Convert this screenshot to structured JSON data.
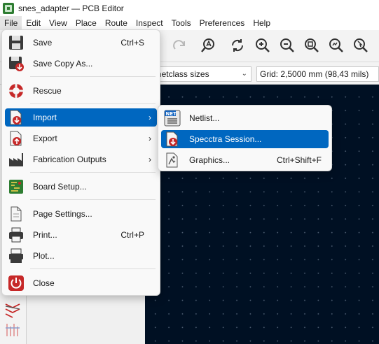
{
  "window": {
    "title": "snes_adapter — PCB Editor"
  },
  "menubar": [
    {
      "label": "File",
      "active": true
    },
    {
      "label": "Edit"
    },
    {
      "label": "View"
    },
    {
      "label": "Place"
    },
    {
      "label": "Route"
    },
    {
      "label": "Inspect"
    },
    {
      "label": "Tools"
    },
    {
      "label": "Preferences"
    },
    {
      "label": "Help"
    }
  ],
  "toolbar2": {
    "netclass_combo": "Track: use netclass sizes",
    "grid_combo": "Grid: 2,5000 mm (98,43 mils)"
  },
  "file_menu": {
    "items": [
      {
        "label": "Save",
        "shortcut": "Ctrl+S",
        "icon": "save-icon"
      },
      {
        "label": "Save Copy As...",
        "icon": "save-copy-icon"
      },
      {
        "label": "Rescue",
        "icon": "rescue-icon"
      },
      {
        "label": "Import",
        "icon": "import-icon",
        "submenu": true,
        "highlighted": true
      },
      {
        "label": "Export",
        "icon": "export-icon",
        "submenu": true
      },
      {
        "label": "Fabrication Outputs",
        "icon": "fabrication-icon",
        "submenu": true
      },
      {
        "label": "Board Setup...",
        "icon": "board-setup-icon"
      },
      {
        "label": "Page Settings...",
        "icon": "page-settings-icon"
      },
      {
        "label": "Print...",
        "shortcut": "Ctrl+P",
        "icon": "print-icon"
      },
      {
        "label": "Plot...",
        "icon": "plot-icon"
      },
      {
        "label": "Close",
        "icon": "close-icon"
      }
    ]
  },
  "import_submenu": {
    "items": [
      {
        "label": "Netlist...",
        "icon": "netlist-icon"
      },
      {
        "label": "Specctra Session...",
        "icon": "specctra-icon",
        "highlighted": true
      },
      {
        "label": "Graphics...",
        "shortcut": "Ctrl+Shift+F",
        "icon": "graphics-icon"
      }
    ]
  },
  "colors": {
    "highlight": "#0067c0",
    "canvas_bg": "#001023",
    "accent_red": "#c62828"
  }
}
